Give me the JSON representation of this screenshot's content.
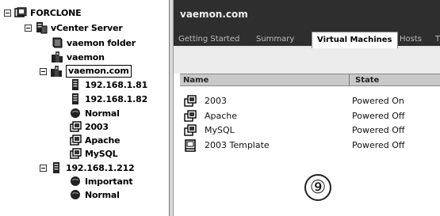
{
  "inventory_tree": {
    "root": "FORCLONE",
    "vcenter": "vCenter Server",
    "folder": "vaemon folder",
    "datacenter_vaemon": "vaemon",
    "datacenter_selected": "vaemon.com",
    "host_1": "192.168.1.81",
    "host_2": "192.168.1.82",
    "pool_normal_1": "Normal",
    "vm_2003": "2003",
    "vm_apache": "Apache",
    "vm_mysql": "MySQL",
    "host_3": "192.168.1.212",
    "pool_important": "Important",
    "pool_normal_2": "Normal"
  },
  "panel": {
    "title": "vaemon.com",
    "tabs": [
      "Getting Started",
      "Summary",
      "Virtual Machines",
      "Hosts",
      "T"
    ],
    "active_tab": "Virtual Machines",
    "columns": {
      "name": "Name",
      "state": "State"
    },
    "rows": [
      {
        "name": "2003",
        "state": "Powered On",
        "icon": "vm-icon"
      },
      {
        "name": "Apache",
        "state": "Powered Off",
        "icon": "vm-icon"
      },
      {
        "name": "MySQL",
        "state": "Powered Off",
        "icon": "vm-icon"
      },
      {
        "name": "2003 Template",
        "state": "Powered Off",
        "icon": "template-icon"
      }
    ]
  },
  "callout": "⑨"
}
